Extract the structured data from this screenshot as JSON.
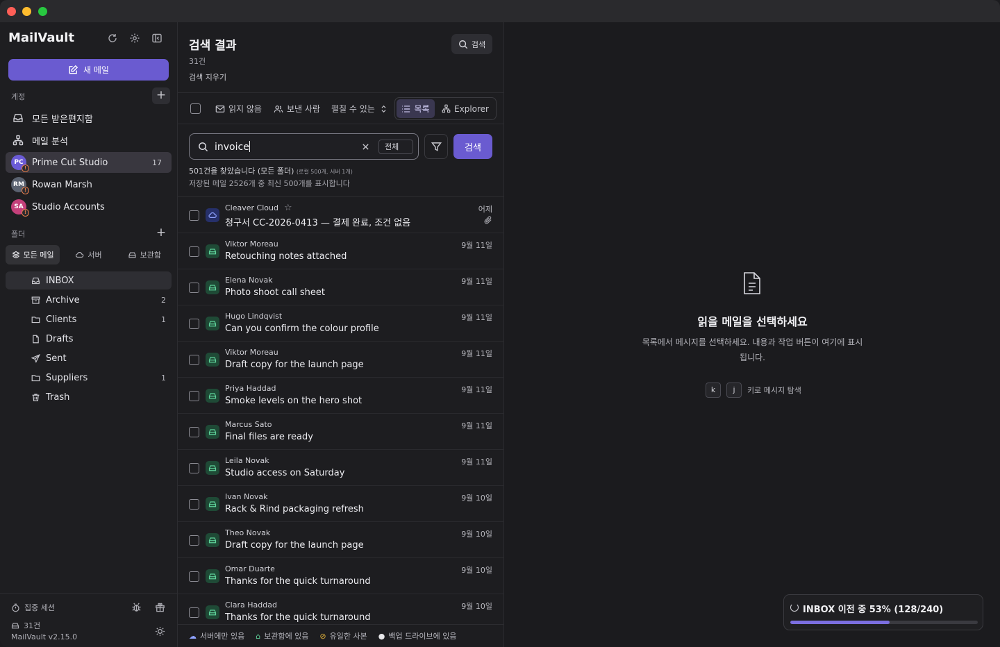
{
  "app": {
    "name": "MailVault",
    "version": "MailVault v2.15.0"
  },
  "sidebar": {
    "compose_label": "새 메일",
    "accounts_label": "계정",
    "accounts": [
      {
        "label": "모든 받은편지함",
        "icon": "inbox-icon"
      },
      {
        "label": "메일 분석",
        "icon": "analytics-icon"
      },
      {
        "label": "Prime Cut Studio",
        "initials": "PC",
        "count": "17",
        "color": "#6b5bd6",
        "active": true
      },
      {
        "label": "Rowan Marsh",
        "initials": "RM",
        "color": "#5a6270"
      },
      {
        "label": "Studio Accounts",
        "initials": "SA",
        "color": "#c4407a"
      }
    ],
    "folders_label": "폴더",
    "folder_tabs": [
      "모든 메일",
      "서버",
      "보관함"
    ],
    "folders": [
      {
        "label": "INBOX",
        "icon": "inbox-icon",
        "count": "",
        "active": true
      },
      {
        "label": "Archive",
        "icon": "archive-icon",
        "count": "2"
      },
      {
        "label": "Clients",
        "icon": "folder-icon",
        "count": "1"
      },
      {
        "label": "Drafts",
        "icon": "file-icon",
        "count": ""
      },
      {
        "label": "Sent",
        "icon": "send-icon",
        "count": ""
      },
      {
        "label": "Suppliers",
        "icon": "folder-icon",
        "count": "1"
      },
      {
        "label": "Trash",
        "icon": "trash-icon",
        "count": ""
      }
    ],
    "footer": {
      "focus_session": "집중 세션",
      "count": "31건"
    }
  },
  "list": {
    "title": "검색 결과",
    "count": "31건",
    "clear_search": "검색 지우기",
    "search_button": "검색",
    "toolbar": {
      "unread": "읽지 않음",
      "sender": "보낸 사람",
      "sort": "펼칠 수 있는 스",
      "view_list": "목록",
      "view_explorer": "Explorer"
    },
    "search": {
      "query": "invoice",
      "scope": "전체",
      "submit": "검색"
    },
    "result_summary": "501건을 찾았습니다 (모든 폴더)",
    "result_detail": "(로컬 500개, 서버 1개)",
    "result_note": "저장된 메일 2526개 중 최신 500개를 표시합니다",
    "messages": [
      {
        "from": "Cleaver Cloud",
        "subject": "청구서 CC-2026-0413 — 결제 완료, 조건 없음",
        "date": "어제",
        "source": "cloud",
        "starred": true,
        "attachment": true
      },
      {
        "from": "Viktor Moreau",
        "subject": "Retouching notes attached",
        "date": "9월 11일",
        "source": "archive"
      },
      {
        "from": "Elena Novak",
        "subject": "Photo shoot call sheet",
        "date": "9월 11일",
        "source": "archive"
      },
      {
        "from": "Hugo Lindqvist",
        "subject": "Can you confirm the colour profile",
        "date": "9월 11일",
        "source": "archive"
      },
      {
        "from": "Viktor Moreau",
        "subject": "Draft copy for the launch page",
        "date": "9월 11일",
        "source": "archive"
      },
      {
        "from": "Priya Haddad",
        "subject": "Smoke levels on the hero shot",
        "date": "9월 11일",
        "source": "archive"
      },
      {
        "from": "Marcus Sato",
        "subject": "Final files are ready",
        "date": "9월 11일",
        "source": "archive"
      },
      {
        "from": "Leila Novak",
        "subject": "Studio access on Saturday",
        "date": "9월 11일",
        "source": "archive"
      },
      {
        "from": "Ivan Novak",
        "subject": "Rack & Rind packaging refresh",
        "date": "9월 10일",
        "source": "archive"
      },
      {
        "from": "Theo Novak",
        "subject": "Draft copy for the launch page",
        "date": "9월 10일",
        "source": "archive"
      },
      {
        "from": "Omar Duarte",
        "subject": "Thanks for the quick turnaround",
        "date": "9월 10일",
        "source": "archive"
      },
      {
        "from": "Clara Haddad",
        "subject": "Thanks for the quick turnaround",
        "date": "9월 10일",
        "source": "archive"
      }
    ],
    "legend": [
      "서버에만 있음",
      "보관함에 있음",
      "유일한 사본",
      "백업 드라이브에 있음"
    ]
  },
  "reader": {
    "empty_title": "읽을 메일을 선택하세요",
    "empty_desc": "목록에서 메시지를 선택하세요. 내용과 작업 버튼이 여기에 표시됩니다.",
    "key_k": "k",
    "key_j": "j",
    "key_hint": "키로 메시지 탐색"
  },
  "toast": {
    "text": "INBOX 이전 중 53% (128/240)",
    "progress": 0.53
  },
  "colors": {
    "accent": "#6a5bd0",
    "cloud": "#8fa3ff",
    "archive": "#5fd39b",
    "warning": "#e07a4a"
  }
}
